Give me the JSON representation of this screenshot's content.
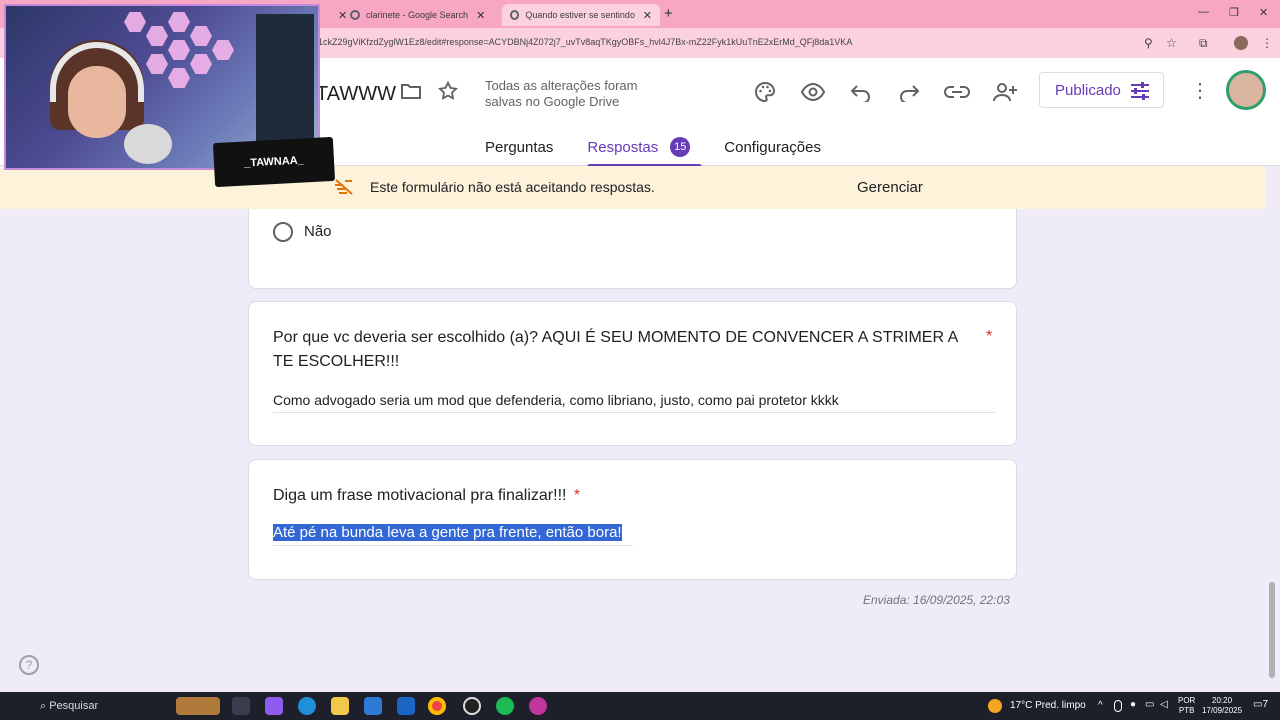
{
  "browser": {
    "tabs": [
      {
        "title": "clarinete - Google Search"
      },
      {
        "title": "Quando estiver se sentindo de"
      }
    ],
    "new_tab": "+",
    "url": "1ckZ29gViKfzdZyglW1Ez8/edit#response=ACYDBNj4Z072j7_uvTv8aqTKgyOBFs_hvl4J7Bx-mZ22Fyk1kUuTnE2xErMd_QFj8da1VKA"
  },
  "header": {
    "form_title": "TAWWW",
    "saved_status": "Todas as alterações foram salvas no Google Drive",
    "publish_label": "Publicado",
    "tabs": [
      {
        "label": "Perguntas"
      },
      {
        "label": "Respostas",
        "count": "15"
      },
      {
        "label": "Configurações"
      }
    ]
  },
  "banner": {
    "text": "Este formulário não está aceitando respostas.",
    "action": "Gerenciar"
  },
  "cards": {
    "radio_option": "Não",
    "q1": {
      "title": "Por que vc deveria ser escolhido (a)?  AQUI É SEU MOMENTO DE CONVENCER A STRIMER A TE ESCOLHER!!!",
      "required": "*",
      "answer": "Como advogado seria um mod que defenderia, como libriano, justo, como pai protetor kkkk"
    },
    "q2": {
      "title": "Diga um frase motivacional pra finalizar!!!",
      "required": "*",
      "answer": "Até pé na bunda leva a gente pra frente, então bora!"
    }
  },
  "sent": "Enviada: 16/09/2025, 22:03",
  "overlay": {
    "tag": "_TAWNAA_"
  },
  "taskbar": {
    "search": "Pesquisar",
    "weather": "17°C  Pred. limpo",
    "lang_top": "POR",
    "lang_bottom": "PTB",
    "time": "20:20",
    "date": "17/09/2025",
    "notifications": "7"
  },
  "colors": {
    "accent": "#673ab7",
    "required": "#d93025",
    "banner": "#fcf3da",
    "selection": "#3367d6"
  }
}
